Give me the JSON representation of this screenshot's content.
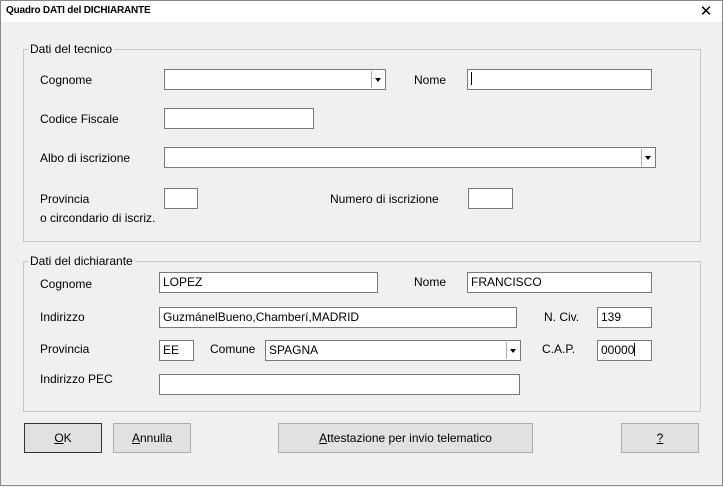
{
  "window": {
    "title": "Quadro DATI del DICHIARANTE",
    "close_icon": "close-icon"
  },
  "tecnico": {
    "legend": "Dati del tecnico",
    "cognome_label": "Cognome",
    "cognome_value": "",
    "nome_label": "Nome",
    "nome_value": "",
    "codice_fiscale_label": "Codice Fiscale",
    "codice_fiscale_value": "",
    "albo_label": "Albo di iscrizione",
    "albo_value": "",
    "provincia_label_1": "Provincia",
    "provincia_label_2": "o circondario di iscriz.",
    "provincia_value": "",
    "numero_label": "Numero di iscrizione",
    "numero_value": ""
  },
  "dichiarante": {
    "legend": "Dati del dichiarante",
    "cognome_label": "Cognome",
    "cognome_value": "LOPEZ",
    "nome_label": "Nome",
    "nome_value": "FRANCISCO",
    "indirizzo_label": "Indirizzo",
    "indirizzo_value": "GuzmánelBueno,Chamberí,MADRID",
    "nciv_label": "N. Civ.",
    "nciv_value": "139",
    "provincia_label": "Provincia",
    "provincia_value": "EE",
    "comune_label": "Comune",
    "comune_value": "SPAGNA",
    "cap_label": "C.A.P.",
    "cap_value": "00000",
    "pec_label": "Indirizzo PEC",
    "pec_value": ""
  },
  "buttons": {
    "ok_prefix": "O",
    "ok_rest": "K",
    "annulla_prefix": "A",
    "annulla_rest": "nnulla",
    "attestazione_prefix": "A",
    "attestazione_rest": "ttestazione per invio telematico",
    "help": "?"
  }
}
